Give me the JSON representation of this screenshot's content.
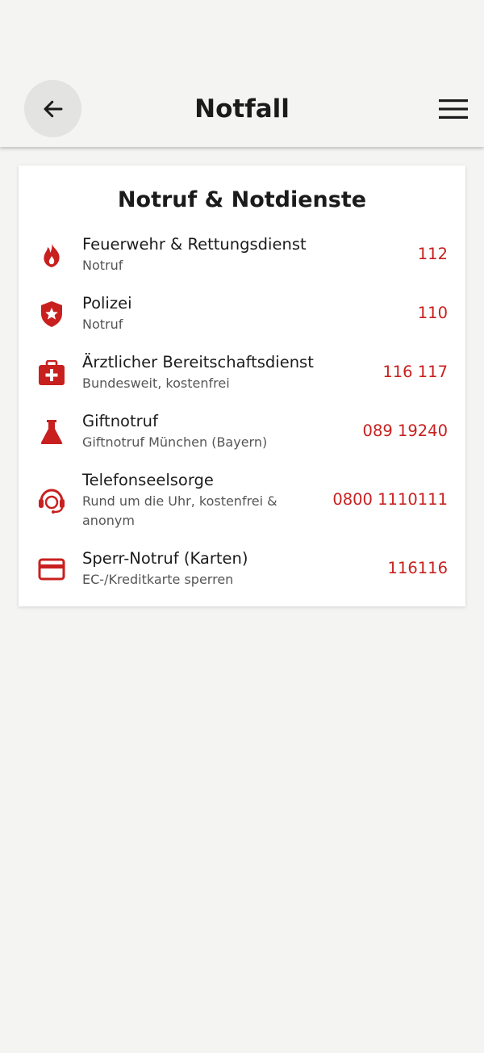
{
  "header": {
    "title": "Notfall",
    "back_icon": "arrow-left-icon",
    "menu_icon": "hamburger-menu-icon"
  },
  "card": {
    "title": "Notruf & Notdienste",
    "accent_color": "#c8201f",
    "items": [
      {
        "icon": "flame-icon",
        "title": "Feuerwehr & Rettungsdienst",
        "subtitle": "Notruf",
        "number": "112"
      },
      {
        "icon": "police-shield-icon",
        "title": "Polizei",
        "subtitle": "Notruf",
        "number": "110"
      },
      {
        "icon": "medical-kit-icon",
        "title": "Ärztlicher Bereitschaftsdienst",
        "subtitle": "Bundesweit, kostenfrei",
        "number": "116 117"
      },
      {
        "icon": "flask-icon",
        "title": "Giftnotruf",
        "subtitle": "Giftnotruf München (Bayern)",
        "number": "089 19240"
      },
      {
        "icon": "headset-icon",
        "title": "Telefonseelsorge",
        "subtitle": "Rund um die Uhr, kostenfrei & anonym",
        "number": "0800 1110111"
      },
      {
        "icon": "credit-card-icon",
        "title": "Sperr-Notruf (Karten)",
        "subtitle": "EC-/Kreditkarte sperren",
        "number": "116116"
      }
    ]
  }
}
